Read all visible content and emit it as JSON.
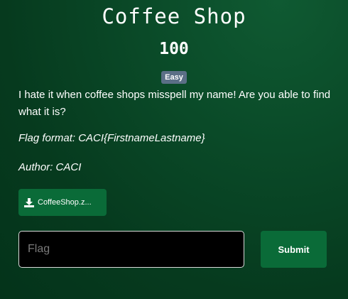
{
  "challenge": {
    "title": "Coffee Shop",
    "points": "100",
    "difficulty": "Easy",
    "description": "I hate it when coffee shops misspell my name! Are you able to find what it is?",
    "flag_format": "Flag format: CACI{FirstnameLastname}",
    "author": "Author: CACI"
  },
  "attachment": {
    "label": "CoffeeShop.z...",
    "icon": "download-icon"
  },
  "form": {
    "flag_placeholder": "Flag",
    "flag_value": "",
    "submit_label": "Submit"
  },
  "colors": {
    "background": "#063a1e",
    "button": "#0a6b38",
    "badge": "#5b6f86",
    "input_background": "#000000"
  }
}
